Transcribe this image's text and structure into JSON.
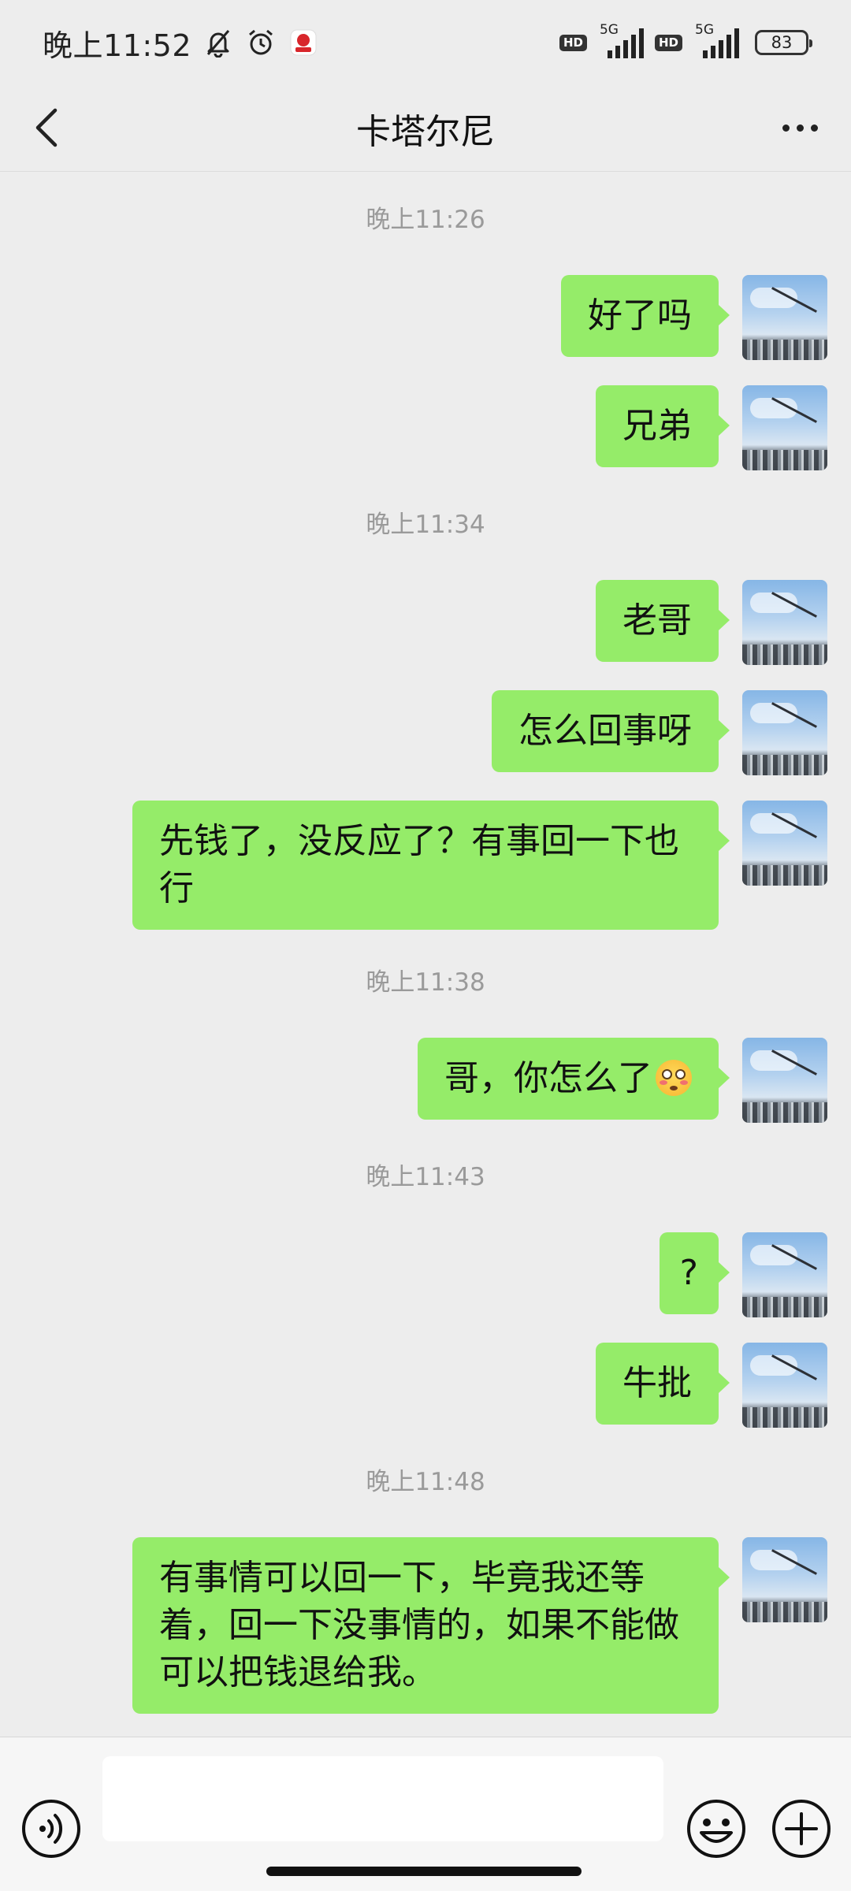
{
  "status_bar": {
    "time": "晚上11:52",
    "icons": [
      "bell-off-icon",
      "alarm-icon",
      "app-notification-icon"
    ],
    "sim1": {
      "badge": "HD",
      "network": "5G"
    },
    "sim2": {
      "badge": "HD",
      "network": "5G"
    },
    "battery": "83"
  },
  "header": {
    "title": "卡塔尔尼",
    "back_icon": "chevron-left-icon",
    "more_icon": "more-icon"
  },
  "colors": {
    "bubble": "#95ec69",
    "background": "#ededed",
    "timestamp": "#9a9a9a"
  },
  "chat": {
    "timestamps": [
      "晚上11:26",
      "晚上11:34",
      "晚上11:38",
      "晚上11:43",
      "晚上11:48"
    ],
    "messages": [
      {
        "text": "好了吗"
      },
      {
        "text": "兄弟"
      },
      {
        "text": "老哥"
      },
      {
        "text": "怎么回事呀"
      },
      {
        "text": "先钱了，没反应了？有事回一下也行"
      },
      {
        "text": "哥，你怎么了",
        "emoji": "flushed-face-emoji"
      },
      {
        "text": "?"
      },
      {
        "text": "牛批"
      },
      {
        "text": "有事情可以回一下，毕竟我还等着，回一下没事情的，如果不能做可以把钱退给我。"
      }
    ]
  },
  "input_bar": {
    "voice_icon": "voice-icon",
    "input_value": "",
    "emoji_icon": "emoji-icon",
    "plus_icon": "plus-icon"
  }
}
